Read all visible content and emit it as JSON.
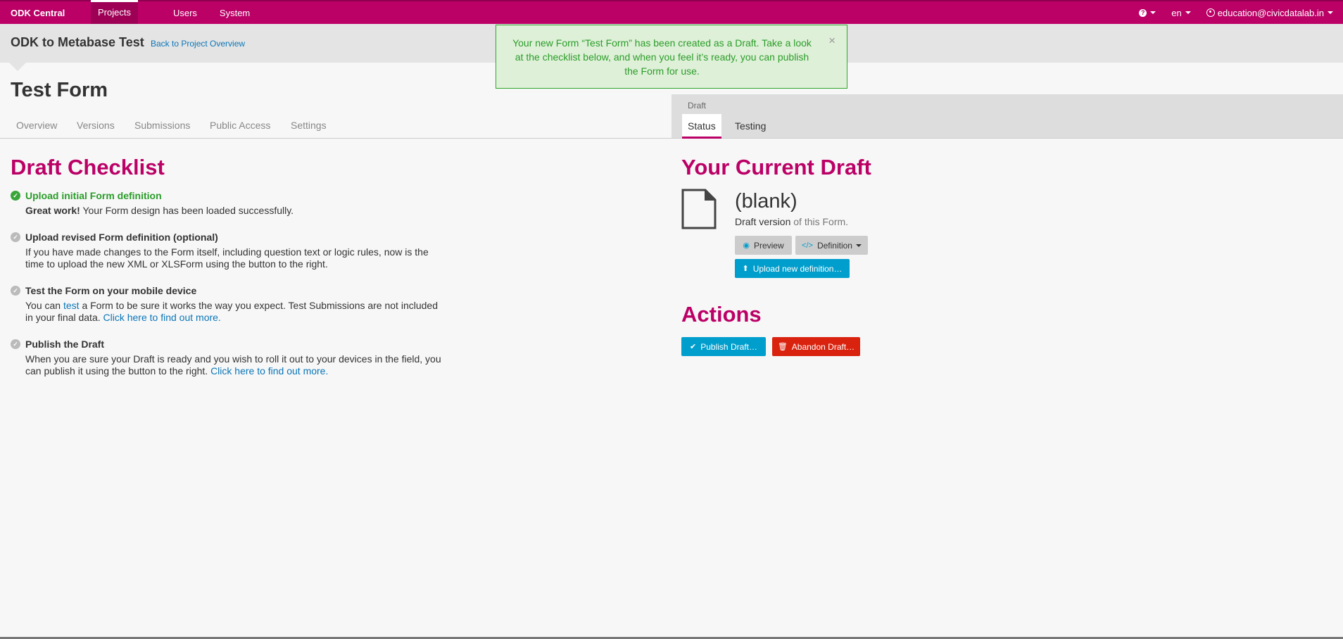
{
  "navbar": {
    "brand": "ODK Central",
    "items": [
      "Projects",
      "Users",
      "System"
    ],
    "help_icon": "question-circle-icon",
    "language": "en",
    "user": "education@civicdatalab.in"
  },
  "header": {
    "project": "ODK to Metabase Test",
    "back_link": "Back to Project Overview"
  },
  "form": {
    "title": "Test Form",
    "tabs": [
      "Overview",
      "Versions",
      "Submissions",
      "Public Access",
      "Settings"
    ]
  },
  "draft_panel": {
    "label": "Draft",
    "tabs": [
      "Status",
      "Testing"
    ]
  },
  "checklist": {
    "heading": "Draft Checklist",
    "items": [
      {
        "title": "Upload initial Form definition",
        "done": true,
        "body_strong": "Great work!",
        "body": " Your Form design has been loaded successfully."
      },
      {
        "title": "Upload revised Form definition (optional)",
        "done": false,
        "body": "If you have made changes to the Form itself, including question text or logic rules, now is the time to upload the new XML or XLSForm using the button to the right."
      },
      {
        "title": "Test the Form on your mobile device",
        "done": false,
        "body_pre": "You can ",
        "body_link": "test",
        "body_mid": " a Form to be sure it works the way you expect. Test Submissions are not included in your final data. ",
        "body_link2": "Click here to find out more."
      },
      {
        "title": "Publish the Draft",
        "done": false,
        "body": "When you are sure your Draft is ready and you wish to roll it out to your devices in the field, you can publish it using the button to the right. ",
        "body_link": "Click here to find out more."
      }
    ]
  },
  "current_draft": {
    "heading": "Your Current Draft",
    "version": "(blank)",
    "version_label": "Draft version",
    "version_suffix": " of this Form.",
    "preview_button": "Preview",
    "definition_button": "Definition",
    "upload_button": "Upload new definition…"
  },
  "actions": {
    "heading": "Actions",
    "publish_button": "Publish Draft…",
    "abandon_button": "Abandon Draft…"
  },
  "alert": {
    "message": "Your new Form “Test Form” has been created as a Draft. Take a look at the checklist below, and when you feel it’s ready, you can publish the Form for use.",
    "close": "×"
  },
  "colors": {
    "brand": "#bb0066",
    "success": "#2a9d2a",
    "primary": "#009ecc",
    "danger": "#d9230f"
  }
}
